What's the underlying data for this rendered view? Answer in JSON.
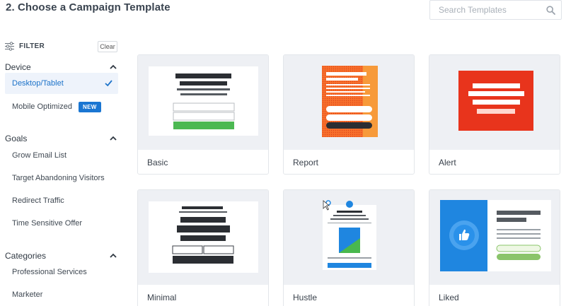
{
  "header": {
    "title": "2. Choose a Campaign Template",
    "search_placeholder": "Search Templates",
    "search_icon": "search-icon"
  },
  "filter": {
    "label": "FILTER",
    "clear_label": "Clear"
  },
  "groups": {
    "device": {
      "title": "Device",
      "items": [
        {
          "label": "Desktop/Tablet",
          "selected": true
        },
        {
          "label": "Mobile Optimized",
          "badge": "NEW"
        }
      ]
    },
    "goals": {
      "title": "Goals",
      "items": [
        {
          "label": "Grow Email List"
        },
        {
          "label": "Target Abandoning Visitors"
        },
        {
          "label": "Redirect Traffic"
        },
        {
          "label": "Time Sensitive Offer"
        }
      ]
    },
    "categories": {
      "title": "Categories",
      "items": [
        {
          "label": "Professional Services"
        },
        {
          "label": "Marketer"
        }
      ]
    }
  },
  "templates": [
    {
      "name": "Basic"
    },
    {
      "name": "Report"
    },
    {
      "name": "Alert"
    },
    {
      "name": "Minimal"
    },
    {
      "name": "Hustle"
    },
    {
      "name": "Liked"
    }
  ],
  "colors": {
    "accent": "#1a76d2",
    "active_bg": "#eef3fb",
    "report_orange": "#f5581f",
    "alert_red": "#e8341c",
    "liked_blue": "#1f86e0",
    "green": "#49b84e"
  }
}
